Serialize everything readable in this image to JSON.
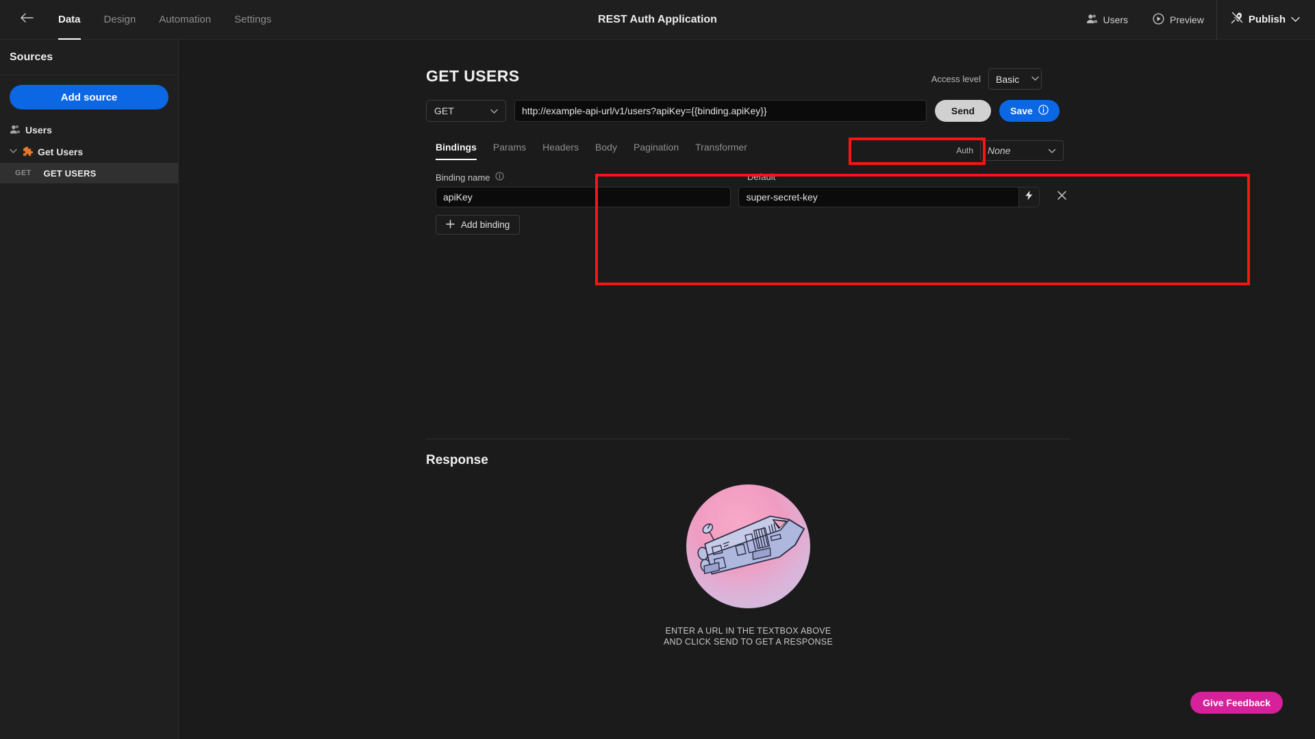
{
  "header": {
    "back_icon": "arrow-left-icon",
    "nav_tabs": [
      {
        "label": "Data",
        "active": true
      },
      {
        "label": "Design",
        "active": false
      },
      {
        "label": "Automation",
        "active": false
      },
      {
        "label": "Settings",
        "active": false
      }
    ],
    "app_title": "REST Auth Application",
    "users_label": "Users",
    "users_icon": "users-icon",
    "preview_label": "Preview",
    "preview_icon": "play-circle-icon",
    "publish_label": "Publish",
    "publish_icon": "rocket-icon",
    "publish_caret": "chevron-down-icon"
  },
  "sidebar": {
    "title": "Sources",
    "add_source_label": "Add source",
    "items": [
      {
        "label": "Users",
        "icon": "users-icon",
        "type": "table"
      },
      {
        "label": "Get Users",
        "icon": "rest-datasource-icon",
        "type": "datasource",
        "expanded": true
      }
    ],
    "queries": [
      {
        "verb": "GET",
        "name": "GET USERS",
        "selected": true
      }
    ]
  },
  "main": {
    "page_title": "GET USERS",
    "access_level_label": "Access level",
    "access_level_value": "Basic",
    "method": "GET",
    "url": "http://example-api-url/v1/users?apiKey={{binding.apiKey}}",
    "url_prefix": "http://example-api-url/v1/users",
    "url_highlight": "apiKey={{binding.apiKey}}",
    "send_label": "Send",
    "save_label": "Save",
    "save_info_icon": "info-circle-icon",
    "tabs": [
      {
        "label": "Bindings",
        "active": true
      },
      {
        "label": "Params",
        "active": false
      },
      {
        "label": "Headers",
        "active": false
      },
      {
        "label": "Body",
        "active": false
      },
      {
        "label": "Pagination",
        "active": false
      },
      {
        "label": "Transformer",
        "active": false
      }
    ],
    "auth_label": "Auth",
    "auth_value": "None",
    "binding_name_label": "Binding name",
    "binding_name_info_icon": "info-circle-icon",
    "default_label": "Default",
    "bindings": [
      {
        "name": "apiKey",
        "default": "super-secret-key"
      }
    ],
    "bolt_icon": "lightning-bolt-icon",
    "remove_icon": "close-icon",
    "add_binding_label": "Add binding",
    "add_binding_icon": "plus-icon"
  },
  "response": {
    "title": "Response",
    "empty_line1": "ENTER A URL IN THE TEXTBOX ABOVE",
    "empty_line2": "AND CLICK SEND TO GET A RESPONSE",
    "illustration": "spaceship-illustration"
  },
  "feedback": {
    "label": "Give Feedback"
  },
  "colors": {
    "accent_blue": "#0b67e4",
    "annotation_red": "#fb1414",
    "feedback_pink": "#d6219b",
    "background": "#1b1b1b",
    "panel": "#1f1f1f"
  }
}
